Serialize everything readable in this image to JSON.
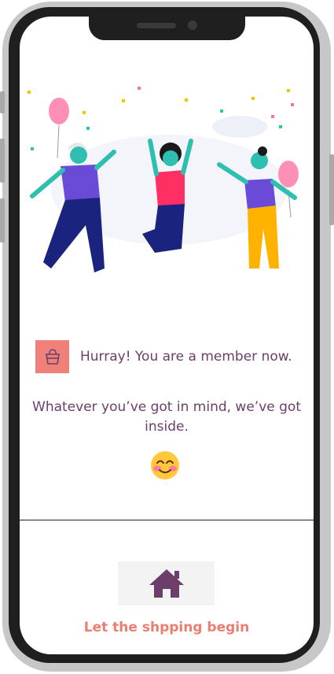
{
  "member": {
    "message": "Hurray! You are a member now.",
    "icon": "shopping-bag-icon"
  },
  "tagline": "Whatever you’ve got in mind, we’ve got inside.",
  "emoji": "smiling-face-icon",
  "cta": {
    "icon": "home-icon",
    "label": "Let the shpping begin"
  },
  "colors": {
    "accent": "#ea7e6f",
    "icon_bg": "#f0807a",
    "text": "#6b3f6a"
  }
}
